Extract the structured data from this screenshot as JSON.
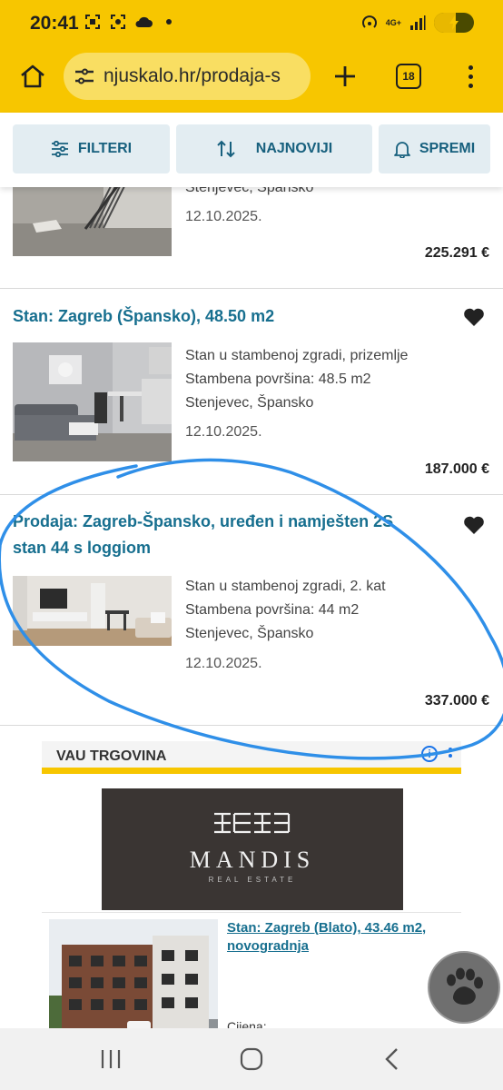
{
  "status_bar": {
    "time": "20:41",
    "network": "4G+",
    "battery_level": 0.55
  },
  "browser": {
    "url": "njuskalo.hr/prodaja-s",
    "tab_count": "18"
  },
  "toolbar": {
    "filters_label": "FILTERI",
    "sort_label": "NAJNOVIJI",
    "save_label": "SPREMI"
  },
  "listings": [
    {
      "title": "",
      "desc": [
        "Stenjevec, Špansko"
      ],
      "date": "12.10.2025.",
      "price": "225.291 €"
    },
    {
      "title": "Stan: Zagreb (Špansko), 48.50 m2",
      "desc": [
        "Stan u stambenoj zgradi, prizemlje",
        "Stambena površina: 48.5 m2",
        "Stenjevec, Špansko"
      ],
      "date": "12.10.2025.",
      "price": "187.000 €"
    },
    {
      "title": "Prodaja: Zagreb-Špansko, uređen i namješten 2S stan 44 s loggiom",
      "desc": [
        "Stan u stambenoj zgradi, 2. kat",
        "Stambena površina: 44 m2",
        "Stenjevec, Špansko"
      ],
      "date": "12.10.2025.",
      "price": "337.000 €"
    }
  ],
  "ad": {
    "header": "VAU TRGOVINA",
    "logo_text": "MANDIS",
    "logo_sub": "REAL ESTATE",
    "link": "Stan: Zagreb (Blato), 43.46 m2, novogradnja",
    "price_label": "Cijena:"
  },
  "colors": {
    "chrome_yellow": "#f7c600",
    "link_blue": "#176f8f",
    "button_bg": "#e3edf2",
    "annotation_blue": "#2f8fe8"
  },
  "icons": {
    "home": "home-icon",
    "tune": "tune-icon",
    "plus": "plus-icon",
    "menu": "more-vert-icon",
    "filters": "sliders-icon",
    "sort": "sort-arrows-icon",
    "save": "bell-icon",
    "heart": "heart-icon",
    "paw": "paw-icon",
    "nav_recent": "recent-apps-icon",
    "nav_home": "nav-home-icon",
    "nav_back": "back-icon"
  }
}
